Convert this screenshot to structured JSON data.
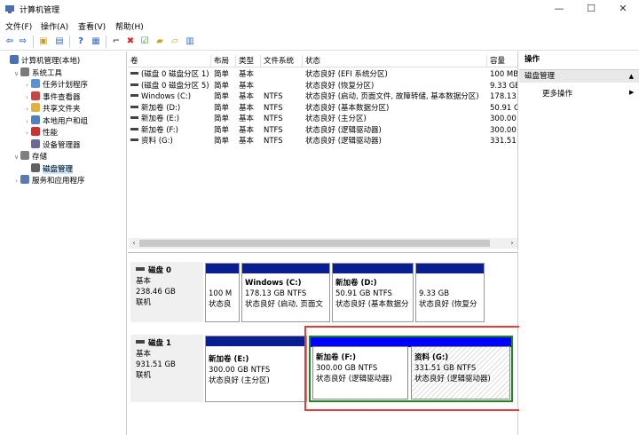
{
  "window": {
    "title": "计算机管理",
    "minimize": "—",
    "maximize": "☐",
    "close": "✕"
  },
  "menu": [
    "文件(F)",
    "操作(A)",
    "查看(V)",
    "帮助(H)"
  ],
  "tree": [
    {
      "label": "计算机管理(本地)",
      "icon": "computer-icon",
      "color": "#4a6fb5",
      "indent": 0,
      "exp": ""
    },
    {
      "label": "系统工具",
      "icon": "tools-icon",
      "color": "#7a7a7a",
      "indent": 1,
      "exp": "∨"
    },
    {
      "label": "任务计划程序",
      "icon": "clock-icon",
      "color": "#5b8fd6",
      "indent": 2,
      "exp": "›"
    },
    {
      "label": "事件查看器",
      "icon": "event-viewer-icon",
      "color": "#c44",
      "indent": 2,
      "exp": "›"
    },
    {
      "label": "共享文件夹",
      "icon": "shared-folder-icon",
      "color": "#e0b040",
      "indent": 2,
      "exp": "›"
    },
    {
      "label": "本地用户和组",
      "icon": "users-icon",
      "color": "#5080c0",
      "indent": 2,
      "exp": "›"
    },
    {
      "label": "性能",
      "icon": "performance-icon",
      "color": "#d03030",
      "indent": 2,
      "exp": "›"
    },
    {
      "label": "设备管理器",
      "icon": "device-manager-icon",
      "color": "#6a6a9a",
      "indent": 2,
      "exp": ""
    },
    {
      "label": "存储",
      "icon": "storage-icon",
      "color": "#808080",
      "indent": 1,
      "exp": "∨"
    },
    {
      "label": "磁盘管理",
      "icon": "disk-management-icon",
      "color": "#606060",
      "indent": 2,
      "exp": "",
      "selected": true
    },
    {
      "label": "服务和应用程序",
      "icon": "services-icon",
      "color": "#5a7ab0",
      "indent": 1,
      "exp": "›"
    }
  ],
  "volumes": {
    "headers": [
      "卷",
      "布局",
      "类型",
      "文件系统",
      "状态",
      "容量"
    ],
    "rows": [
      [
        "(磁盘 0 磁盘分区 1)",
        "简单",
        "基本",
        "",
        "状态良好 (EFI 系统分区)",
        "100 MB"
      ],
      [
        "(磁盘 0 磁盘分区 5)",
        "简单",
        "基本",
        "",
        "状态良好 (恢复分区)",
        "9.33 GB"
      ],
      [
        "Windows (C:)",
        "简单",
        "基本",
        "NTFS",
        "状态良好 (启动, 页面文件, 故障转储, 基本数据分区)",
        "178.13"
      ],
      [
        "新加卷 (D:)",
        "简单",
        "基本",
        "NTFS",
        "状态良好 (基本数据分区)",
        "50.91 G"
      ],
      [
        "新加卷 (E:)",
        "简单",
        "基本",
        "NTFS",
        "状态良好 (主分区)",
        "300.00"
      ],
      [
        "新加卷 (F:)",
        "简单",
        "基本",
        "NTFS",
        "状态良好 (逻辑驱动器)",
        "300.00"
      ],
      [
        "资料 (G:)",
        "简单",
        "基本",
        "NTFS",
        "状态良好 (逻辑驱动器)",
        "331.51"
      ]
    ]
  },
  "disks": [
    {
      "name": "磁盘 0",
      "type": "基本",
      "size": "238.46 GB",
      "status": "联机",
      "parts": [
        {
          "name": "",
          "size": "100 M",
          "status": "状态良"
        },
        {
          "name": "Windows  (C:)",
          "size": "178.13 GB NTFS",
          "status": "状态良好 (启动, 页面文"
        },
        {
          "name": "新加卷  (D:)",
          "size": "50.91 GB NTFS",
          "status": "状态良好 (基本数据分"
        },
        {
          "name": "",
          "size": "9.33 GB",
          "status": "状态良好 (恢复分"
        }
      ]
    },
    {
      "name": "磁盘 1",
      "type": "基本",
      "size": "931.51 GB",
      "status": "联机",
      "parts": [
        {
          "name": "新加卷  (E:)",
          "size": "300.00 GB NTFS",
          "status": "状态良好 (主分区)"
        },
        {
          "name": "新加卷  (F:)",
          "size": "300.00 GB NTFS",
          "status": "状态良好 (逻辑驱动器)"
        },
        {
          "name": "资料  (G:)",
          "size": "331.51 GB NTFS",
          "status": "状态良好 (逻辑驱动器)"
        }
      ]
    }
  ],
  "actions": {
    "header": "操作",
    "section": "磁盘管理",
    "more": "更多操作"
  }
}
